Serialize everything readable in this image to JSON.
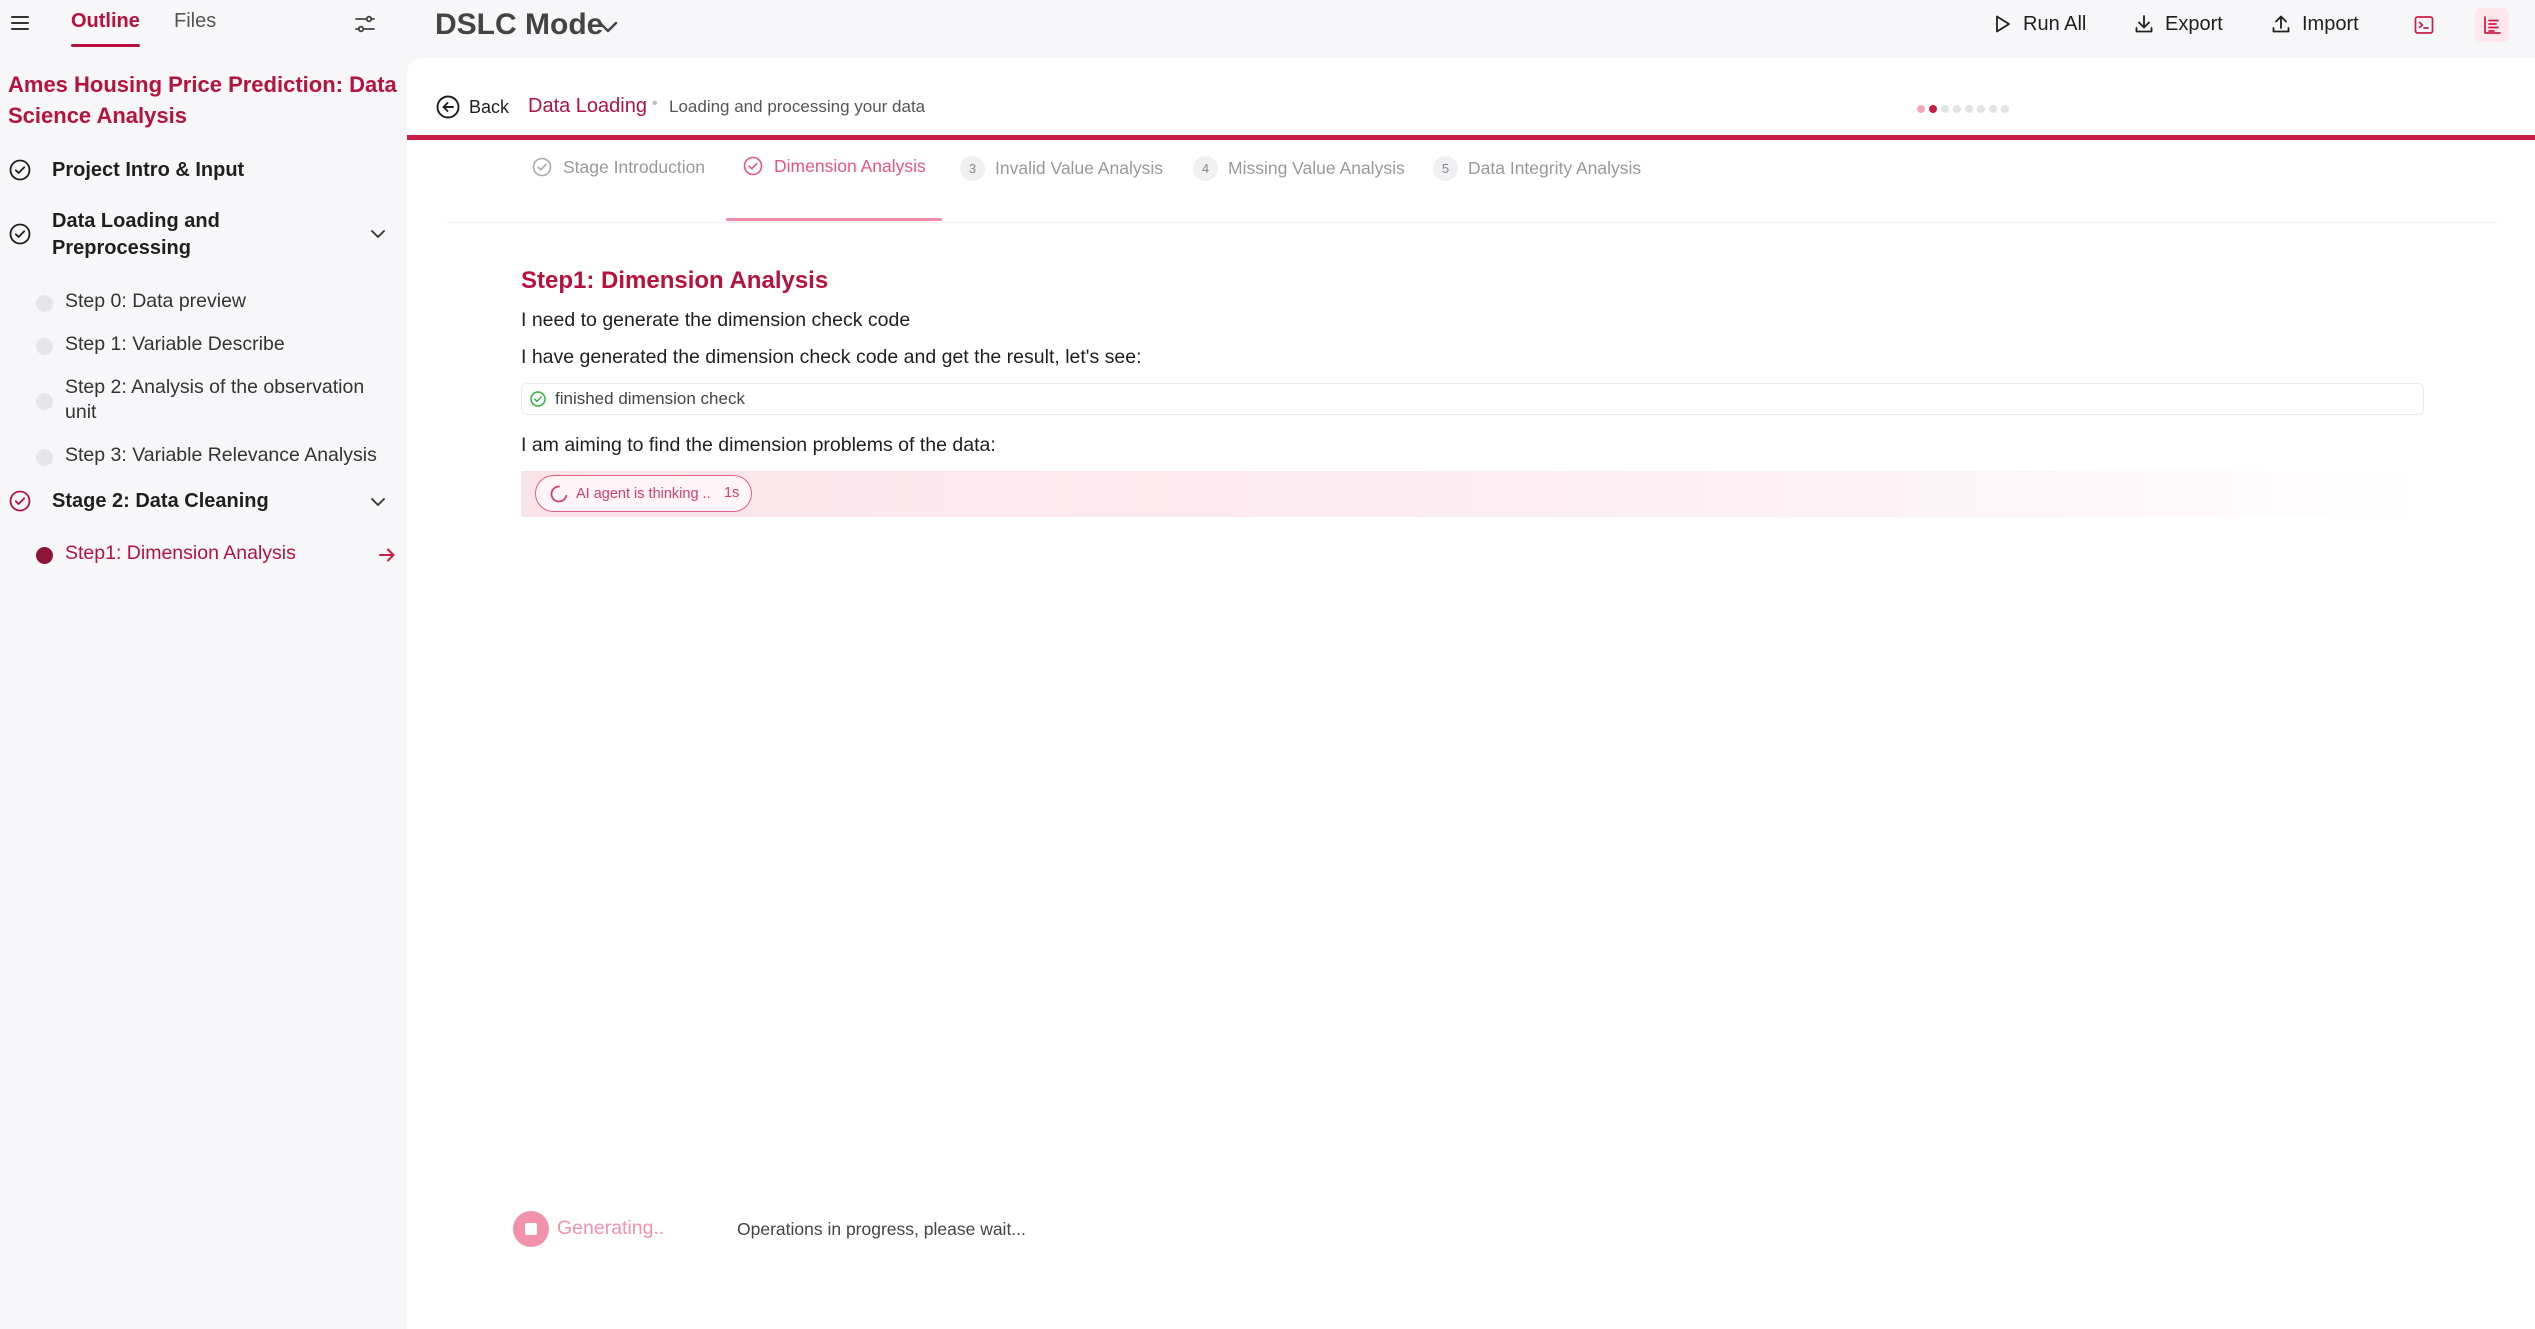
{
  "sidebar": {
    "tabs": {
      "outline": "Outline",
      "files": "Files"
    },
    "project_title": "Ames Housing Price Prediction: Data Science Analysis",
    "stages": [
      {
        "label": "Project Intro & Input"
      },
      {
        "label": "Data Loading and Preprocessing"
      },
      {
        "label": "Stage 2: Data Cleaning"
      }
    ],
    "stage1_steps": [
      {
        "label": "Step 0: Data preview"
      },
      {
        "label": "Step 1: Variable Describe"
      },
      {
        "label": "Step 2: Analysis of the observation unit"
      },
      {
        "label": "Step 3: Variable Relevance Analysis"
      }
    ],
    "stage2_steps": [
      {
        "label": "Step1: Dimension Analysis"
      }
    ]
  },
  "topbar": {
    "mode": "DSLC Mode",
    "run_all": "Run All",
    "export": "Export",
    "import": "Import"
  },
  "main": {
    "back": "Back",
    "stage_name": "Data Loading",
    "separator": "•",
    "stage_desc": "Loading and processing your data",
    "progress": {
      "total": 8,
      "current": 2
    },
    "tabs": [
      {
        "label": "Stage Introduction",
        "state": "done"
      },
      {
        "label": "Dimension Analysis",
        "state": "active"
      },
      {
        "num": "3",
        "label": "Invalid Value Analysis"
      },
      {
        "num": "4",
        "label": "Missing Value Analysis"
      },
      {
        "num": "5",
        "label": "Data Integrity Analysis"
      }
    ],
    "step_title": "Step1: Dimension Analysis",
    "paragraphs": [
      "I need to generate the dimension check code",
      "I have generated the dimension check code and get the result, let's see:",
      "I am aiming to find the dimension problems of the data:"
    ],
    "result": "finished dimension check",
    "thinking": {
      "text": "AI agent is thinking ..",
      "seconds": "1s"
    },
    "footer": {
      "generating": "Generating..",
      "status": "Operations in progress, please wait..."
    }
  },
  "colors": {
    "accent": "#b5123e",
    "accent_light": "#e8557c",
    "success": "#2fb344"
  }
}
